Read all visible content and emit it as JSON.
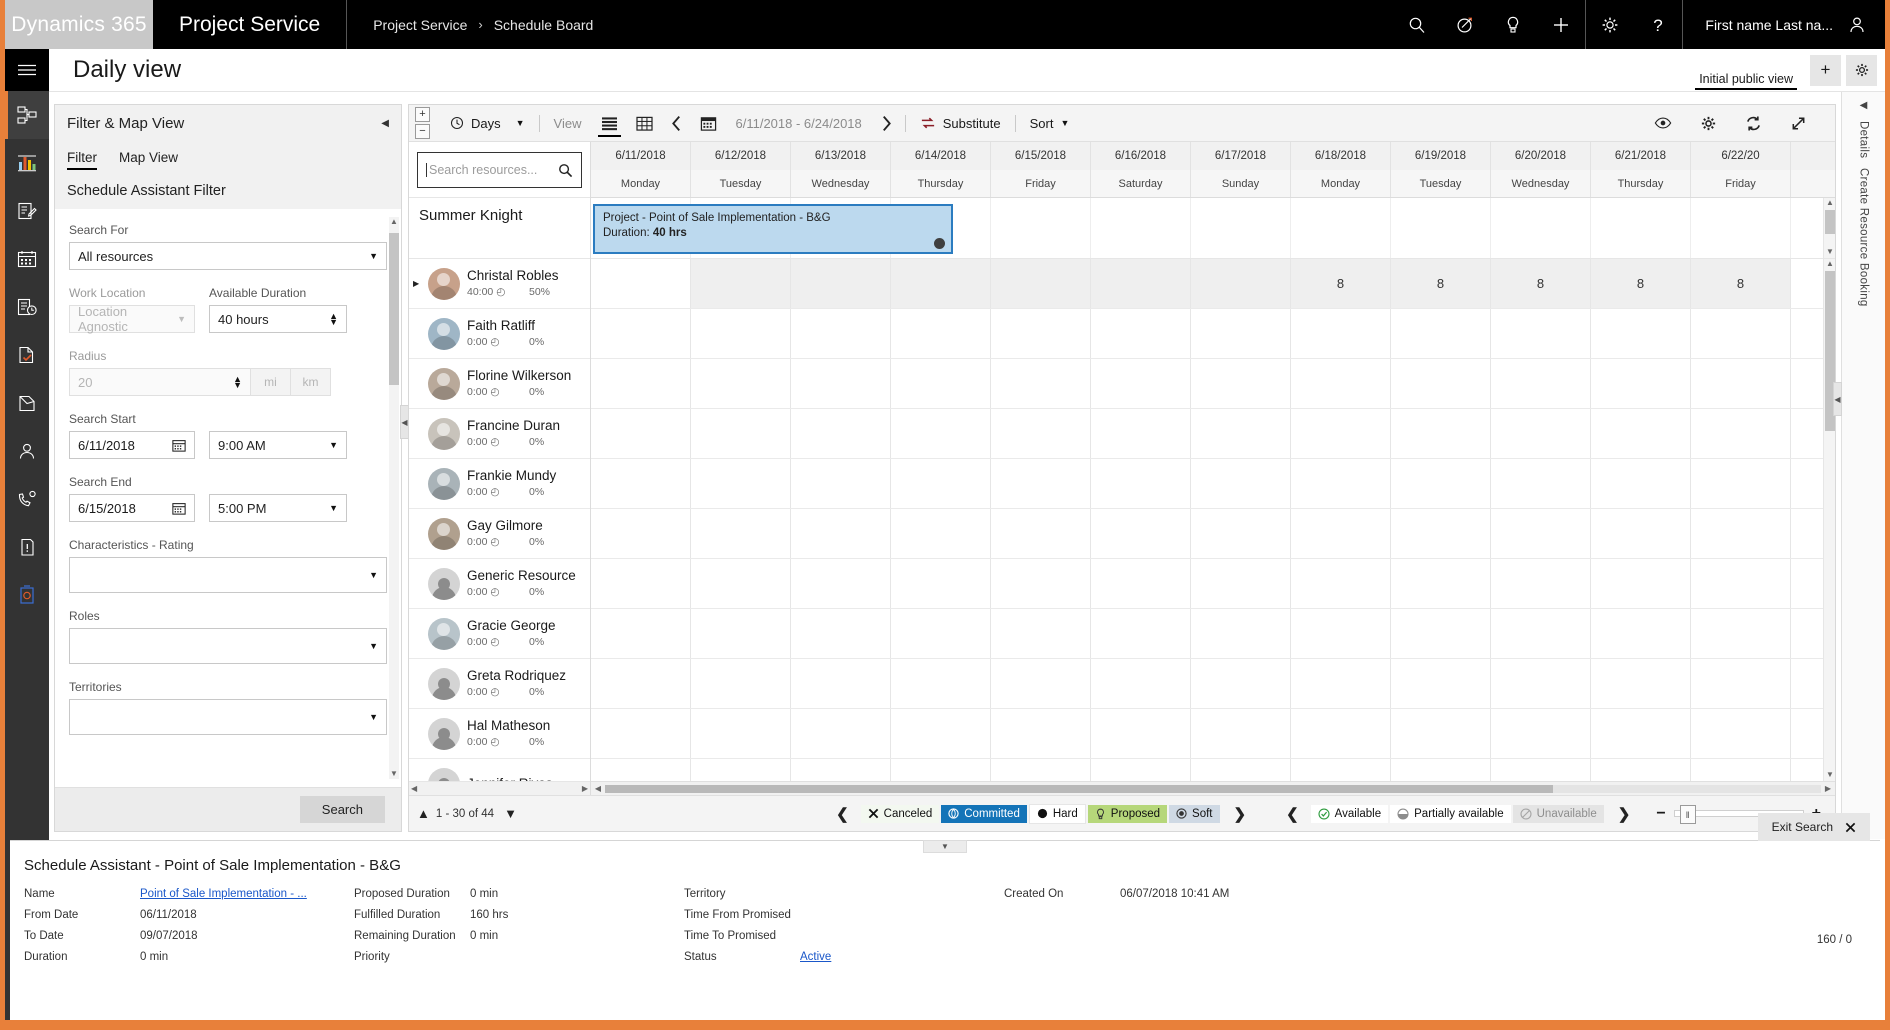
{
  "topnav": {
    "brand": "Dynamics 365",
    "app_name": "Project Service",
    "breadcrumb": [
      "Project Service",
      "Schedule Board"
    ],
    "breadcrumb_separator": "›",
    "icons": [
      "search-icon",
      "assistant-icon",
      "insights-icon",
      "plus-icon",
      "gear-icon",
      "help-icon"
    ],
    "user_label": "First name Last na..."
  },
  "rail": {
    "items": [
      {
        "name": "menu-burger",
        "label": "Menu"
      },
      {
        "name": "sitemap",
        "label": "Site Map"
      },
      {
        "name": "dashboards",
        "label": "Dashboards"
      },
      {
        "name": "activities",
        "label": "Activities"
      },
      {
        "name": "calendar",
        "label": "Calendar"
      },
      {
        "name": "timeentries",
        "label": "Time Entries"
      },
      {
        "name": "approvals",
        "label": "Approvals"
      },
      {
        "name": "projects",
        "label": "Projects"
      },
      {
        "name": "resources",
        "label": "Resources"
      },
      {
        "name": "service",
        "label": "Service"
      },
      {
        "name": "cases",
        "label": "Cases"
      },
      {
        "name": "settings",
        "label": "Settings"
      }
    ]
  },
  "header": {
    "title": "Daily view",
    "view_tab": "Initial public view",
    "add_button": "+",
    "settings_button": "gear-icon"
  },
  "filter_panel": {
    "title": "Filter & Map View",
    "collapse_icon": "chevron-left-icon",
    "tabs": [
      {
        "label": "Filter",
        "active": true
      },
      {
        "label": "Map View",
        "active": false
      }
    ],
    "section_title": "Schedule Assistant Filter",
    "fields": {
      "search_for": {
        "label": "Search For",
        "value": "All resources"
      },
      "work_location": {
        "label": "Work Location",
        "value": "Location Agnostic",
        "disabled": true
      },
      "available_duration": {
        "label": "Available Duration",
        "value": "40 hours"
      },
      "radius": {
        "label": "Radius",
        "value": "20",
        "disabled": true,
        "unit_mi": "mi",
        "unit_km": "km"
      },
      "search_start": {
        "label": "Search Start",
        "date": "6/11/2018",
        "time": "9:00 AM"
      },
      "search_end": {
        "label": "Search End",
        "date": "6/15/2018",
        "time": "5:00 PM"
      },
      "characteristics_rating": {
        "label": "Characteristics - Rating",
        "value": ""
      },
      "roles": {
        "label": "Roles",
        "value": ""
      },
      "territories": {
        "label": "Territories",
        "value": ""
      }
    },
    "search_button": "Search"
  },
  "board_toolbar": {
    "zoom_in": "+",
    "zoom_out": "−",
    "scale_label": "Days",
    "scale_caret": "▼",
    "view_label": "View",
    "view_list_icon": "list-view-icon",
    "view_grid_icon": "grid-view-icon",
    "prev_icon": "chevron-left-icon",
    "calendar_icon": "calendar-icon",
    "date_range": "6/11/2018 - 6/24/2018",
    "next_icon": "chevron-right-icon",
    "substitute_label": "Substitute",
    "sort_label": "Sort",
    "sort_caret": "▼",
    "right_icons": [
      "eye-icon",
      "gear-icon",
      "refresh-icon",
      "expand-icon"
    ]
  },
  "resource_list": {
    "search_placeholder": "Search resources...",
    "group_header": "Summer Knight",
    "resources": [
      {
        "name": "Christal Robles",
        "hours": "40:00",
        "percent": "50%",
        "avatar": "photo",
        "expandable": true
      },
      {
        "name": "Faith Ratliff",
        "hours": "0:00",
        "percent": "0%",
        "avatar": "photo",
        "expandable": false
      },
      {
        "name": "Florine Wilkerson",
        "hours": "0:00",
        "percent": "0%",
        "avatar": "photo",
        "expandable": false
      },
      {
        "name": "Francine Duran",
        "hours": "0:00",
        "percent": "0%",
        "avatar": "photo",
        "expandable": false
      },
      {
        "name": "Frankie Mundy",
        "hours": "0:00",
        "percent": "0%",
        "avatar": "photo",
        "expandable": false
      },
      {
        "name": "Gay Gilmore",
        "hours": "0:00",
        "percent": "0%",
        "avatar": "photo",
        "expandable": false
      },
      {
        "name": "Generic Resource",
        "hours": "0:00",
        "percent": "0%",
        "avatar": "generic",
        "expandable": false
      },
      {
        "name": "Gracie George",
        "hours": "0:00",
        "percent": "0%",
        "avatar": "photo",
        "expandable": false
      },
      {
        "name": "Greta Rodriquez",
        "hours": "0:00",
        "percent": "0%",
        "avatar": "generic",
        "expandable": false
      },
      {
        "name": "Hal Matheson",
        "hours": "0:00",
        "percent": "0%",
        "avatar": "generic",
        "expandable": false
      },
      {
        "name": "Jennifer Rivas",
        "hours": "",
        "percent": "",
        "avatar": "generic",
        "expandable": false
      }
    ]
  },
  "timeline": {
    "columns": [
      {
        "date": "6/11/2018",
        "day": "Monday"
      },
      {
        "date": "6/12/2018",
        "day": "Tuesday"
      },
      {
        "date": "6/13/2018",
        "day": "Wednesday"
      },
      {
        "date": "6/14/2018",
        "day": "Thursday"
      },
      {
        "date": "6/15/2018",
        "day": "Friday"
      },
      {
        "date": "6/16/2018",
        "day": "Saturday"
      },
      {
        "date": "6/17/2018",
        "day": "Sunday"
      },
      {
        "date": "6/18/2018",
        "day": "Monday"
      },
      {
        "date": "6/19/2018",
        "day": "Tuesday"
      },
      {
        "date": "6/20/2018",
        "day": "Wednesday"
      },
      {
        "date": "6/21/2018",
        "day": "Thursday"
      },
      {
        "date": "6/22/20",
        "day": "Friday"
      }
    ],
    "booking": {
      "title": "Project - Point of Sale Implementation - B&G",
      "duration_label": "Duration:",
      "duration_value": "40 hrs"
    },
    "first_row_capacity": [
      "",
      "",
      "",
      "",
      "",
      "",
      "",
      "8",
      "8",
      "8",
      "8",
      "8",
      ""
    ]
  },
  "legend_bar": {
    "page_up_icon": "chevron-up-icon",
    "page_down_icon": "chevron-down-icon",
    "pager": "1 - 30 of 44",
    "booking_status": [
      {
        "label": "Cancelled",
        "text": "Cancelled",
        "icon": "x-icon",
        "style": "cancel"
      },
      {
        "label": "Committed",
        "text": "Committed",
        "icon": "commit-icon",
        "style": "commit"
      },
      {
        "label": "Hard",
        "text": "Hard",
        "icon": "filled-circle-icon",
        "style": "hard"
      },
      {
        "label": "Proposed",
        "text": "Proposed",
        "icon": "bulb-icon",
        "style": "prop"
      },
      {
        "label": "Soft",
        "text": "Soft",
        "icon": "target-icon",
        "style": "soft"
      }
    ],
    "cancelled_display": "Canceled",
    "availability_status": [
      {
        "label": "Available",
        "icon": "check-circle-icon",
        "style": "avail"
      },
      {
        "label": "Partially available",
        "icon": "half-circle-icon",
        "style": "partial"
      },
      {
        "label": "Unavailable",
        "icon": "ban-icon",
        "style": "unavail"
      }
    ],
    "zoom_out": "−",
    "zoom_in": "+"
  },
  "details_rail": {
    "collapse_icon": "chevron-left-icon",
    "label_details": "Details",
    "label_create": "Create Resource Booking"
  },
  "detail_panel": {
    "title": "Schedule Assistant - Point of Sale Implementation - B&G",
    "exit_search": "Exit Search",
    "exit_icon": "close-icon",
    "column1": [
      {
        "label": "Name",
        "value": "Point of Sale Implementation - ...",
        "link": true
      },
      {
        "label": "From Date",
        "value": "06/11/2018",
        "link": false
      },
      {
        "label": "To Date",
        "value": "09/07/2018",
        "link": false
      },
      {
        "label": "Duration",
        "value": "0 min",
        "link": false
      }
    ],
    "column2": [
      {
        "label": "Proposed Duration",
        "value": "0 min",
        "link": false
      },
      {
        "label": "Fulfilled Duration",
        "value": "160 hrs",
        "link": false
      },
      {
        "label": "Remaining Duration",
        "value": "0 min",
        "link": false
      },
      {
        "label": "Priority",
        "value": "",
        "link": false
      }
    ],
    "column3": [
      {
        "label": "Territory",
        "value": "",
        "link": false
      },
      {
        "label": "Time From Promised",
        "value": "",
        "link": false
      },
      {
        "label": "Time To Promised",
        "value": "",
        "link": false
      },
      {
        "label": "Status",
        "value": "Active",
        "link": true
      }
    ],
    "column4": [
      {
        "label": "Created On",
        "value": "06/07/2018 10:41 AM",
        "link": false
      }
    ],
    "ratio": "160 / 0"
  },
  "colors": {
    "accent_orange": "#e8803a",
    "booking_fill": "#bcd9ee",
    "booking_border": "#2b7cc0",
    "committed": "#1474b8",
    "proposed": "#b6d77a",
    "soft": "#cfd9e4",
    "link": "#1a57c9",
    "available_green": "#2e9b3e"
  }
}
